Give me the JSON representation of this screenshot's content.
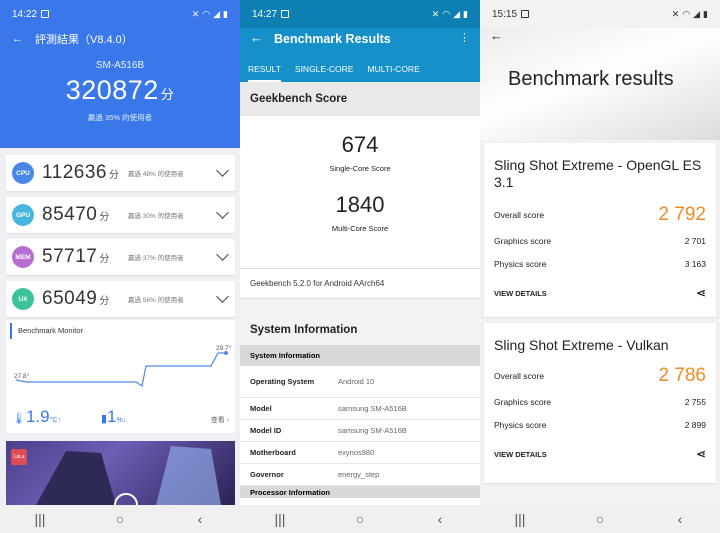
{
  "antutu": {
    "status": {
      "time": "14:22"
    },
    "toolbar_title": "評測結果（V8.4.0）",
    "device": "SM-A516B",
    "total_score": "320872",
    "score_unit": "分",
    "total_beat": "贏過 35% 的使用者",
    "categories": [
      {
        "badge": "CPU",
        "score": "112636",
        "unit": "分",
        "beat": "贏過 48% 的使用者",
        "color": "#4a86e8"
      },
      {
        "badge": "GPU",
        "score": "85470",
        "unit": "分",
        "beat": "贏過 30% 的使用者",
        "color": "#46b6e0"
      },
      {
        "badge": "MEM",
        "score": "57717",
        "unit": "分",
        "beat": "贏過 37% 的使用者",
        "color": "#b66fd0"
      },
      {
        "badge": "UX",
        "score": "65049",
        "unit": "分",
        "beat": "贏過 56% 的使用者",
        "color": "#3cc39b"
      }
    ],
    "monitor": {
      "title": "Benchmark Monitor",
      "start_temp": "27.8°",
      "end_temp": "29.7°",
      "temp_delta": "1.9",
      "temp_unit": "°C↑",
      "battery_delta": "1",
      "battery_unit": "%↓",
      "more": "查看"
    },
    "ad": {
      "logo_text": "LaLa"
    }
  },
  "geekbench": {
    "status": {
      "time": "14:27"
    },
    "title": "Benchmark Results",
    "tabs": [
      "RESULT",
      "SINGLE-CORE",
      "MULTI-CORE"
    ],
    "score_header": "Geekbench Score",
    "single_score": "674",
    "single_label": "Single-Core Score",
    "multi_score": "1840",
    "multi_label": "Multi-Core Score",
    "version": "Geekbench 5.2.0 for Android AArch64",
    "sysinfo_header": "System Information",
    "sysinfo_sub": "System Information",
    "rows": [
      {
        "k": "Operating System",
        "v": "Android 10"
      },
      {
        "k": "Model",
        "v": "samsung SM-A516B"
      },
      {
        "k": "Model ID",
        "v": "samsung SM-A516B"
      },
      {
        "k": "Motherboard",
        "v": "exynos980"
      },
      {
        "k": "Governor",
        "v": "energy_step"
      }
    ],
    "partial_sub": "Processor Information"
  },
  "threedmark": {
    "status": {
      "time": "15:15"
    },
    "title": "Benchmark results",
    "cards": [
      {
        "title": "Sling Shot Extreme - OpenGL ES 3.1",
        "overall_label": "Overall score",
        "overall": "2 792",
        "graphics_label": "Graphics score",
        "graphics": "2 701",
        "physics_label": "Physics score",
        "physics": "3 163",
        "details": "VIEW DETAILS"
      },
      {
        "title": "Sling Shot Extreme - Vulkan",
        "overall_label": "Overall score",
        "overall": "2 786",
        "graphics_label": "Graphics score",
        "graphics": "2 755",
        "physics_label": "Physics score",
        "physics": "2 899",
        "details": "VIEW DETAILS"
      }
    ]
  },
  "navbar": {
    "recent": "|||",
    "home": "○",
    "back": "‹"
  }
}
